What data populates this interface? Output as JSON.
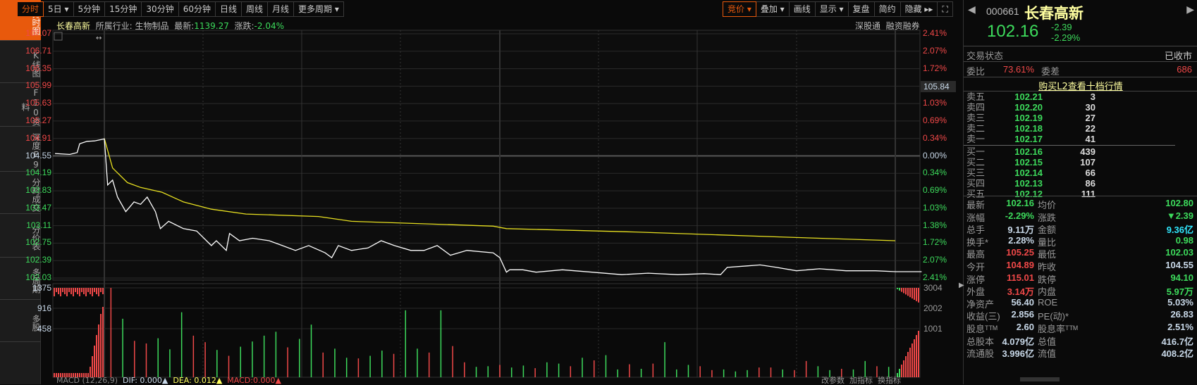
{
  "sidebar": [
    {
      "label": "分时图",
      "active": true
    },
    {
      "label": "K线图"
    },
    {
      "label": "F10资料"
    },
    {
      "label": "深度F9"
    },
    {
      "label": "分时成交"
    },
    {
      "label": "分价表"
    },
    {
      "label": "多周期"
    },
    {
      "label": "多股"
    }
  ],
  "toolbar": {
    "left": [
      "分时",
      "5日 ▾",
      "5分钟",
      "15分钟",
      "30分钟",
      "60分钟",
      "日线",
      "周线",
      "月线",
      "更多周期 ▾"
    ],
    "right": [
      "竞价 ▾",
      "叠加 ▾",
      "画线",
      "显示 ▾",
      "复盘",
      "简约",
      "隐藏 ▸▸",
      "⛶"
    ]
  },
  "info": {
    "name": "长春高新",
    "industry_label": "所属行业:",
    "industry": "生物制品",
    "latest_label": "最新:",
    "latest": "1139.27",
    "change_label": "涨跌:",
    "change": "-2.04%",
    "links": [
      "深股通",
      "融资融券"
    ]
  },
  "price_axis": [
    "107.07",
    "106.71",
    "106.35",
    "105.99",
    "105.63",
    "105.27",
    "104.91",
    "104.55",
    "104.19",
    "103.83",
    "103.47",
    "103.11",
    "102.75",
    "102.39",
    "102.03"
  ],
  "pct_axis": [
    "2.41%",
    "2.07%",
    "1.72%",
    "1.38%",
    "1.03%",
    "0.69%",
    "0.34%",
    "0.00%",
    "0.34%",
    "0.69%",
    "1.03%",
    "1.38%",
    "1.72%",
    "2.07%",
    "2.41%"
  ],
  "cursor_price": "105.84",
  "vol_axis": [
    "1375",
    "916",
    "458"
  ],
  "vol_axis_right": [
    "3004",
    "2002",
    "1001"
  ],
  "macd": {
    "label": "MACD (12,26,9)",
    "dif": "DIF: 0.000▲",
    "dea": "DEA: 0.012▲",
    "macd": "MACD:0.000▲",
    "buttons": [
      "改参数",
      "加指标",
      "换指标"
    ]
  },
  "chart_data": {
    "type": "line",
    "prev_close": 104.55,
    "ylim": [
      102.03,
      107.07
    ],
    "pre_auction": [
      [
        0,
        104.6
      ],
      [
        0.3,
        104.58
      ],
      [
        0.45,
        104.62
      ],
      [
        0.5,
        104.8
      ],
      [
        0.65,
        104.85
      ],
      [
        0.8,
        104.86
      ],
      [
        1,
        104.9
      ]
    ],
    "price": [
      [
        0,
        104.91
      ],
      [
        1,
        103.95
      ],
      [
        2.5,
        104.05
      ],
      [
        4,
        103.7
      ],
      [
        6.5,
        103.4
      ],
      [
        9,
        103.6
      ],
      [
        11,
        103.55
      ],
      [
        13,
        103.7
      ],
      [
        15.5,
        103.4
      ],
      [
        17,
        103.05
      ],
      [
        19.5,
        103.2
      ],
      [
        24,
        103.05
      ],
      [
        28,
        103.0
      ],
      [
        32.5,
        102.7
      ],
      [
        34,
        102.8
      ],
      [
        37,
        102.6
      ],
      [
        38,
        102.95
      ],
      [
        41,
        102.8
      ],
      [
        45,
        102.85
      ],
      [
        50,
        102.8
      ],
      [
        54,
        102.7
      ],
      [
        58,
        102.6
      ],
      [
        62,
        102.7
      ],
      [
        67,
        102.55
      ],
      [
        69,
        102.45
      ],
      [
        71,
        102.7
      ],
      [
        75,
        102.6
      ],
      [
        80,
        102.65
      ],
      [
        84,
        102.8
      ],
      [
        88,
        102.7
      ],
      [
        93,
        102.6
      ],
      [
        97,
        102.6
      ],
      [
        101,
        102.7
      ],
      [
        105,
        102.5
      ],
      [
        110,
        102.6
      ],
      [
        118,
        102.55
      ],
      [
        120,
        102.45
      ],
      [
        122,
        102.15
      ],
      [
        123,
        102.2
      ],
      [
        127,
        102.2
      ],
      [
        131,
        102.15
      ],
      [
        139,
        102.2
      ],
      [
        148,
        102.15
      ],
      [
        157,
        102.1
      ],
      [
        165,
        102.13
      ],
      [
        174,
        102.1
      ],
      [
        182,
        102.12
      ],
      [
        187,
        102.1
      ],
      [
        189,
        102.25
      ],
      [
        195,
        102.28
      ],
      [
        199,
        102.3
      ],
      [
        204,
        102.25
      ],
      [
        210,
        102.18
      ],
      [
        217,
        102.22
      ],
      [
        225,
        102.18
      ],
      [
        234,
        102.18
      ],
      [
        240,
        102.16
      ],
      [
        248,
        102.16
      ]
    ],
    "avg": [
      [
        0,
        104.91
      ],
      [
        2.5,
        104.3
      ],
      [
        7,
        104.0
      ],
      [
        11,
        103.9
      ],
      [
        17.5,
        103.8
      ],
      [
        24,
        103.6
      ],
      [
        32.5,
        103.45
      ],
      [
        43,
        103.35
      ],
      [
        65,
        103.3
      ],
      [
        75,
        103.2
      ],
      [
        118,
        103.1
      ],
      [
        122,
        103.05
      ],
      [
        161,
        102.98
      ],
      [
        204,
        102.88
      ],
      [
        240,
        102.8
      ]
    ],
    "volume": [
      1375,
      900,
      560,
      520,
      600,
      430,
      1000,
      640,
      540,
      420,
      330,
      470,
      550,
      640,
      700,
      460,
      590,
      810,
      380,
      440,
      300,
      290,
      330,
      410,
      360,
      1030,
      440,
      380,
      1030,
      480,
      230,
      160,
      170,
      190,
      150,
      180,
      140,
      230,
      210,
      170,
      300,
      260,
      340,
      120,
      200,
      130,
      210,
      540,
      120,
      190,
      170,
      110,
      120,
      90,
      110,
      150,
      150,
      120,
      110,
      250,
      170,
      110,
      130,
      120,
      250,
      170,
      160
    ],
    "volume_up": [
      0,
      1,
      0,
      0,
      1,
      1,
      1,
      0,
      0,
      1,
      0,
      1,
      1,
      1,
      1,
      0,
      1,
      1,
      0,
      1,
      1,
      0,
      1,
      1,
      0,
      1,
      1,
      0,
      1,
      0,
      0,
      1,
      1,
      0,
      1,
      1,
      0,
      1,
      1,
      0,
      1,
      0,
      1,
      1,
      0,
      1,
      0,
      1,
      1,
      1,
      0,
      0,
      1,
      1,
      1,
      0,
      0,
      1,
      0,
      0,
      1,
      1,
      0,
      1,
      1,
      0,
      1
    ]
  },
  "quote": {
    "code": "000661",
    "name": "长春高新",
    "price": "102.16",
    "change": "-2.39",
    "pct": "-2.29%",
    "status_label": "交易状态",
    "status": "已收市",
    "wb_label": "委比",
    "wb": "73.61%",
    "wc_label": "委差",
    "wc": "686",
    "l2_link": "购买L2查看十档行情",
    "asks": [
      [
        "卖五",
        "102.21",
        "3"
      ],
      [
        "卖四",
        "102.20",
        "30"
      ],
      [
        "卖三",
        "102.19",
        "27"
      ],
      [
        "卖二",
        "102.18",
        "22"
      ],
      [
        "卖一",
        "102.17",
        "41"
      ]
    ],
    "bids": [
      [
        "买一",
        "102.16",
        "439"
      ],
      [
        "买二",
        "102.15",
        "107"
      ],
      [
        "买三",
        "102.14",
        "66"
      ],
      [
        "买四",
        "102.13",
        "86"
      ],
      [
        "买五",
        "102.12",
        "111"
      ]
    ],
    "stats": [
      [
        "最新",
        "102.16",
        "gr",
        "均价",
        "102.80",
        "gr"
      ],
      [
        "涨幅",
        "-2.29%",
        "gr",
        "涨跌",
        "▼2.39",
        "gr"
      ],
      [
        "总手",
        "9.11万",
        "w",
        "金额",
        "9.36亿",
        "c"
      ],
      [
        "换手*",
        "2.28%",
        "w",
        "量比",
        "0.98",
        "gr"
      ],
      [
        "最高",
        "105.25",
        "r",
        "最低",
        "102.03",
        "gr"
      ],
      [
        "今开",
        "104.89",
        "r",
        "昨收",
        "104.55",
        "w"
      ],
      [
        "涨停",
        "115.01",
        "r",
        "跌停",
        "94.10",
        "gr"
      ],
      [
        "外盘",
        "3.14万",
        "r",
        "内盘",
        "5.97万",
        "gr"
      ],
      [
        "净资产",
        "56.40",
        "w",
        "ROE",
        "5.03%",
        "w"
      ],
      [
        "收益(三)",
        "2.856",
        "w",
        "PE(动)*",
        "26.83",
        "w"
      ],
      [
        "股息ᵀᵀᴹ",
        "2.60",
        "w",
        "股息率ᵀᵀᴹ",
        "2.51%",
        "w"
      ],
      [
        "总股本",
        "4.079亿",
        "w",
        "总值",
        "416.7亿",
        "w"
      ],
      [
        "流通股",
        "3.996亿",
        "w",
        "流值",
        "408.2亿",
        "w"
      ]
    ]
  },
  "colors": {
    "up": "#f04848",
    "down": "#3ddb5c",
    "accent": "#e8590c",
    "avg": "#e8e020"
  }
}
